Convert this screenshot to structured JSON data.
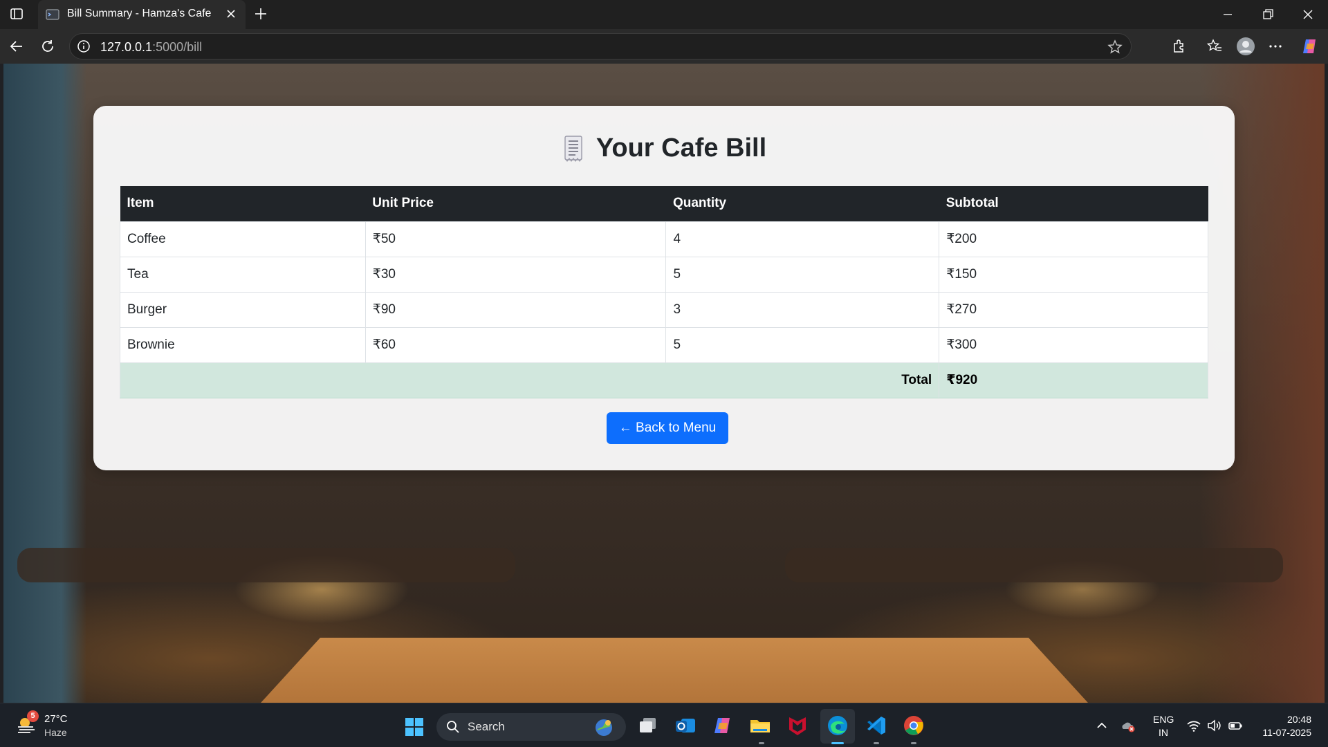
{
  "browser": {
    "tab_title": "Bill Summary - Hamza's Cafe",
    "url_host": "127.0.0.1",
    "url_path": ":5000/bill"
  },
  "page": {
    "title": "Your Cafe Bill",
    "table": {
      "headers": [
        "Item",
        "Unit Price",
        "Quantity",
        "Subtotal"
      ],
      "rows": [
        [
          "Coffee",
          "₹50",
          "4",
          "₹200"
        ],
        [
          "Tea",
          "₹30",
          "5",
          "₹150"
        ],
        [
          "Burger",
          "₹90",
          "3",
          "₹270"
        ],
        [
          "Brownie",
          "₹60",
          "5",
          "₹300"
        ]
      ],
      "total_label": "Total",
      "total_value": "₹920"
    },
    "back_button": "← Back to Menu"
  },
  "taskbar": {
    "weather_badge": "5",
    "weather_temp": "27°C",
    "weather_desc": "Haze",
    "search_label": "Search",
    "lang_line1": "ENG",
    "lang_line2": "IN",
    "time": "20:48",
    "date": "11-07-2025"
  },
  "colors": {
    "header_bg": "#212529",
    "total_row_bg": "#d1e7dd",
    "button_bg": "#0d6efd"
  }
}
